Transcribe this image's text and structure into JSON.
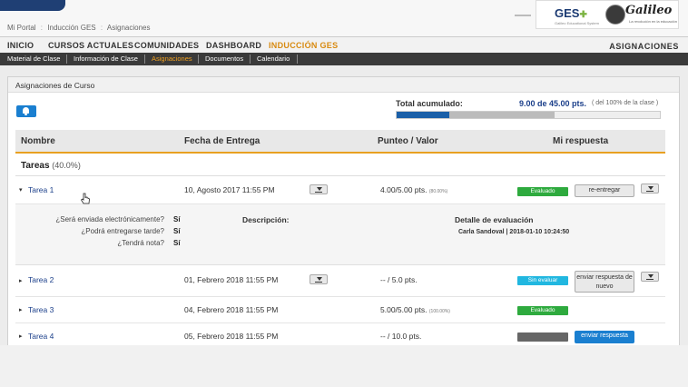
{
  "breadcrumb": [
    "Mi Portal",
    "Inducción GES",
    "Asignaciones"
  ],
  "brand": {
    "ges_name": "GES",
    "ges_sub": "Galileo Educational System",
    "galileo_name": "Galileo",
    "galileo_sub": "La revolución en la educación"
  },
  "main_nav": {
    "items": [
      "INICIO",
      "CURSOS ACTUALES",
      "COMUNIDADES",
      "DASHBOARD",
      "INDUCCIÓN GES"
    ],
    "active": "INDUCCIÓN GES",
    "right_label": "ASIGNACIONES"
  },
  "sub_nav": {
    "items": [
      "Material de Clase",
      "Información de Clase",
      "Asignaciones",
      "Documentos",
      "Calendario"
    ],
    "active": "Asignaciones"
  },
  "panel": {
    "title": "Asignaciones de Curso",
    "bell_icon": "bell-icon",
    "total_label": "Total acumulado:",
    "total_value": "9.00 de 45.00 pts.",
    "total_note": "( del 100% de la clase )",
    "progress_fraction": 0.2,
    "progress_fraction_shaded": 0.6
  },
  "table": {
    "headers": [
      "Nombre",
      "Fecha de Entrega",
      "Punteo / Valor",
      "Mi respuesta"
    ],
    "section": {
      "name": "Tareas",
      "pct": "(40.0%)"
    },
    "rows": [
      {
        "name": "Tarea 1",
        "date": "10, Agosto 2017 11:55 PM",
        "score": "4.00/5.00 pts.",
        "score_pct": "(80.00%)",
        "status": "Evaluado",
        "action": "re-entregar"
      },
      {
        "name": "Tarea 2",
        "date": "01, Febrero 2018 11:55 PM",
        "score": "-- / 5.0 pts.",
        "score_pct": "",
        "status": "Sin evaluar",
        "action": "enviar respuesta de nuevo"
      },
      {
        "name": "Tarea 3",
        "date": "04, Febrero 2018 11:55 PM",
        "score": "5.00/5.00 pts.",
        "score_pct": "(100.00%)",
        "status": "Evaluado",
        "action": ""
      },
      {
        "name": "Tarea 4",
        "date": "05, Febrero 2018 11:55 PM",
        "score": "-- / 10.0 pts.",
        "score_pct": "",
        "status": "",
        "action": "enviar respuesta"
      }
    ],
    "detail": {
      "q1": "¿Será enviada electrónicamente?",
      "a1": "Sí",
      "q2": "¿Podrá entregarse tarde?",
      "a2": "Sí",
      "q3": "¿Tendrá nota?",
      "a3": "Sí",
      "desc_label": "Descripción:",
      "eval_label": "Detalle de evaluación",
      "eval_value": "Carla Sandoval | 2018-01-10 10:24:50"
    }
  }
}
